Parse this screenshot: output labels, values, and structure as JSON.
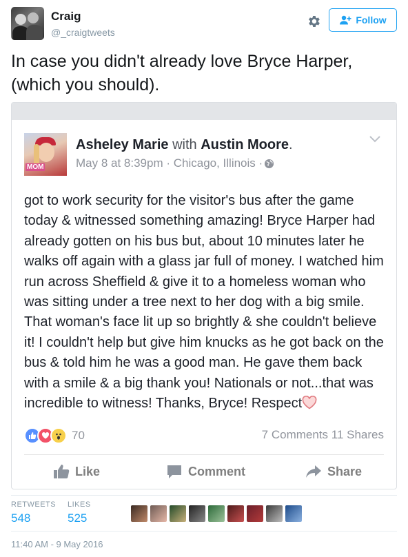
{
  "tweet": {
    "author_name": "Craig",
    "handle": "@_craigtweets",
    "follow_label": "Follow",
    "text": "In case you didn't already love Bryce Harper, (which you should).",
    "retweets_label": "RETWEETS",
    "retweets_count": "548",
    "likes_label": "LIKES",
    "likes_count": "525",
    "timestamp": "11:40 AM - 9 May 2016",
    "accent_color": "#1da1f2",
    "liker_avatar_count": 9
  },
  "fb_post": {
    "author": "Asheley Marie",
    "with_word": "with",
    "tagged": "Austin Moore",
    "period": ".",
    "meta": "May 8 at 8:39pm · Chicago, Illinois ·",
    "body": "got to work security for the visitor's bus after the game today & witnessed something amazing! Bryce Harper had already gotten on his bus but, about 10 minutes later he walks off again with a glass jar full of money. I watched him run across Sheffield & give it to a homeless woman who was sitting under a tree next to her dog with a big smile. That woman's face lit up so brightly & she  couldn't believe it! I couldn't help but give him knucks as he got back on the bus & told him he was a good man. He gave them back with a smile & a big thank you! Nationals or not...that was incredible to witness! Thanks, Bryce! Respect",
    "avatar_tag": "MOM",
    "reaction_count": "70",
    "stats": "7 Comments 11 Shares",
    "actions": {
      "like": "Like",
      "comment": "Comment",
      "share": "Share"
    }
  },
  "icons": {
    "settings": "gear-icon",
    "follow": "add-user-icon",
    "privacy": "globe-icon",
    "menu": "chevron-down-icon",
    "reactions": [
      "like-reaction-icon",
      "love-reaction-icon",
      "wow-reaction-icon"
    ],
    "end_emoji": "heart-emoji"
  }
}
